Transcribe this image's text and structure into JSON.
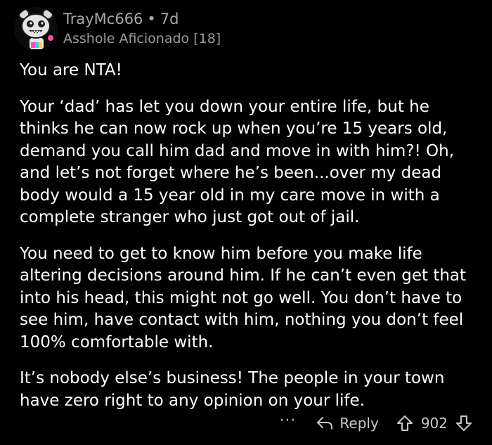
{
  "comment": {
    "username": "TrayMc666",
    "separator": "•",
    "age": "7d",
    "flair": "Asshole Aficionado [18]",
    "paragraphs": [
      "You are NTA!",
      "Your ‘dad’ has let you down your entire life, but he thinks he can now rock up when you’re 15 years old, demand you call him dad and move in with him?! Oh, and let’s not forget where he’s been...over my dead body would a 15 year old in my care move in with a complete stranger who just got out of jail.",
      "You need to get to know him before you make life altering decisions around him. If he can’t even get that into his head, this might not go well. You don’t have to see him, have contact with him, nothing you don’t feel 100% comfortable with.",
      "It’s nobody else’s business! The people in your town have zero right to any opinion on your life."
    ],
    "actions": {
      "more_label": "···",
      "reply_label": "Reply",
      "score": "902"
    }
  },
  "icons": {
    "avatar": "snoo-avatar-icon",
    "reply": "reply-arrow-icon",
    "upvote": "upvote-arrow-icon",
    "downvote": "downvote-arrow-icon"
  },
  "colors": {
    "background": "#000000",
    "text": "#ffffff",
    "meta": "#a7a7a7",
    "actions": "#c8c8c8"
  }
}
